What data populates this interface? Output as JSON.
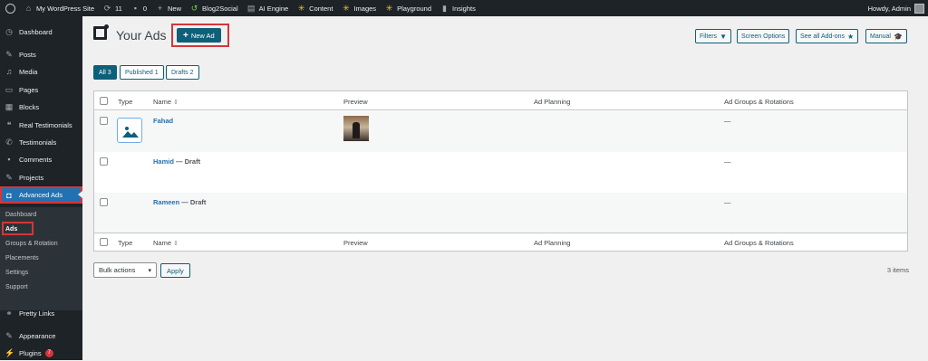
{
  "admin_bar": {
    "site_name": "My WordPress Site",
    "updates_count": "11",
    "comments_count": "0",
    "new_label": "New",
    "blog2social": "Blog2Social",
    "ai_engine": "AI Engine",
    "content": "Content",
    "images": "Images",
    "playground": "Playground",
    "insights": "Insights",
    "howdy": "Howdy, Admin"
  },
  "sidebar": {
    "items": [
      {
        "label": "Dashboard",
        "icon": "dashboard-icon"
      },
      {
        "label": "Posts",
        "icon": "pin-icon"
      },
      {
        "label": "Media",
        "icon": "media-icon"
      },
      {
        "label": "Pages",
        "icon": "page-icon"
      },
      {
        "label": "Blocks",
        "icon": "blocks-icon"
      },
      {
        "label": "Real Testimonials",
        "icon": "quote-icon"
      },
      {
        "label": "Testimonials",
        "icon": "testimonial-icon"
      },
      {
        "label": "Comments",
        "icon": "comment-icon"
      },
      {
        "label": "Projects",
        "icon": "pin-icon"
      },
      {
        "label": "Advanced Ads",
        "icon": "advanced-ads-icon"
      },
      {
        "label": "Pretty Links",
        "icon": "link-icon"
      },
      {
        "label": "Appearance",
        "icon": "brush-icon"
      },
      {
        "label": "Plugins",
        "icon": "plugin-icon",
        "badge": "7"
      }
    ],
    "submenu": [
      "Dashboard",
      "Ads",
      "Groups & Rotation",
      "Placements",
      "Settings",
      "Support"
    ]
  },
  "header": {
    "title": "Your Ads",
    "new_ad": "New Ad",
    "filters": "Filters",
    "screen_options": "Screen Options",
    "see_all_addons": "See all Add-ons",
    "manual": "Manual"
  },
  "filters": {
    "all": "All 3",
    "published": "Published 1",
    "drafts": "Drafts 2"
  },
  "table": {
    "columns": {
      "type": "Type",
      "name": "Name",
      "preview": "Preview",
      "planning": "Ad Planning",
      "groups": "Ad Groups & Rotations"
    },
    "rows": [
      {
        "name": "Fahad",
        "state": "",
        "groups": "—"
      },
      {
        "name": "Hamid",
        "state": " — Draft",
        "groups": "—"
      },
      {
        "name": "Rameen",
        "state": " — Draft",
        "groups": "—"
      }
    ]
  },
  "bottom": {
    "bulk_actions": "Bulk actions",
    "apply": "Apply",
    "items_count": "3 items"
  },
  "colors": {
    "admin_dark": "#1d2327",
    "accent": "#0e5f79",
    "highlight_red": "#d63638",
    "active_menu": "#2271b1"
  }
}
